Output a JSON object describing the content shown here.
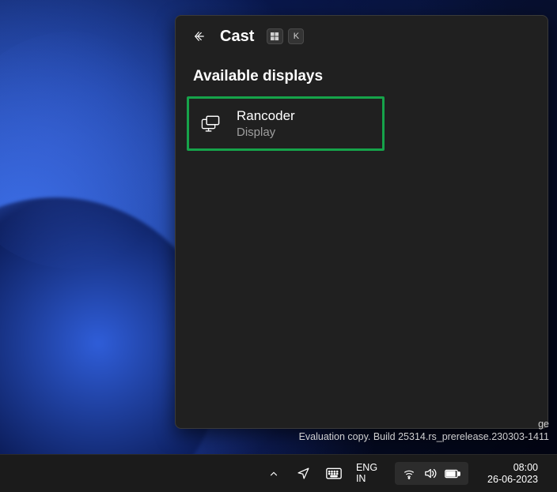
{
  "cast_panel": {
    "title": "Cast",
    "shortcut_keys": {
      "win": "win",
      "k": "K"
    },
    "section_title": "Available displays",
    "devices": [
      {
        "name": "Rancoder",
        "type": "Display"
      }
    ]
  },
  "watermark": {
    "partial_line": "ge",
    "build_line": "Evaluation copy. Build 25314.rs_prerelease.230303-1411"
  },
  "taskbar": {
    "language": {
      "top": "ENG",
      "bottom": "IN"
    },
    "clock": {
      "time": "08:00",
      "date": "26-06-2023"
    }
  }
}
